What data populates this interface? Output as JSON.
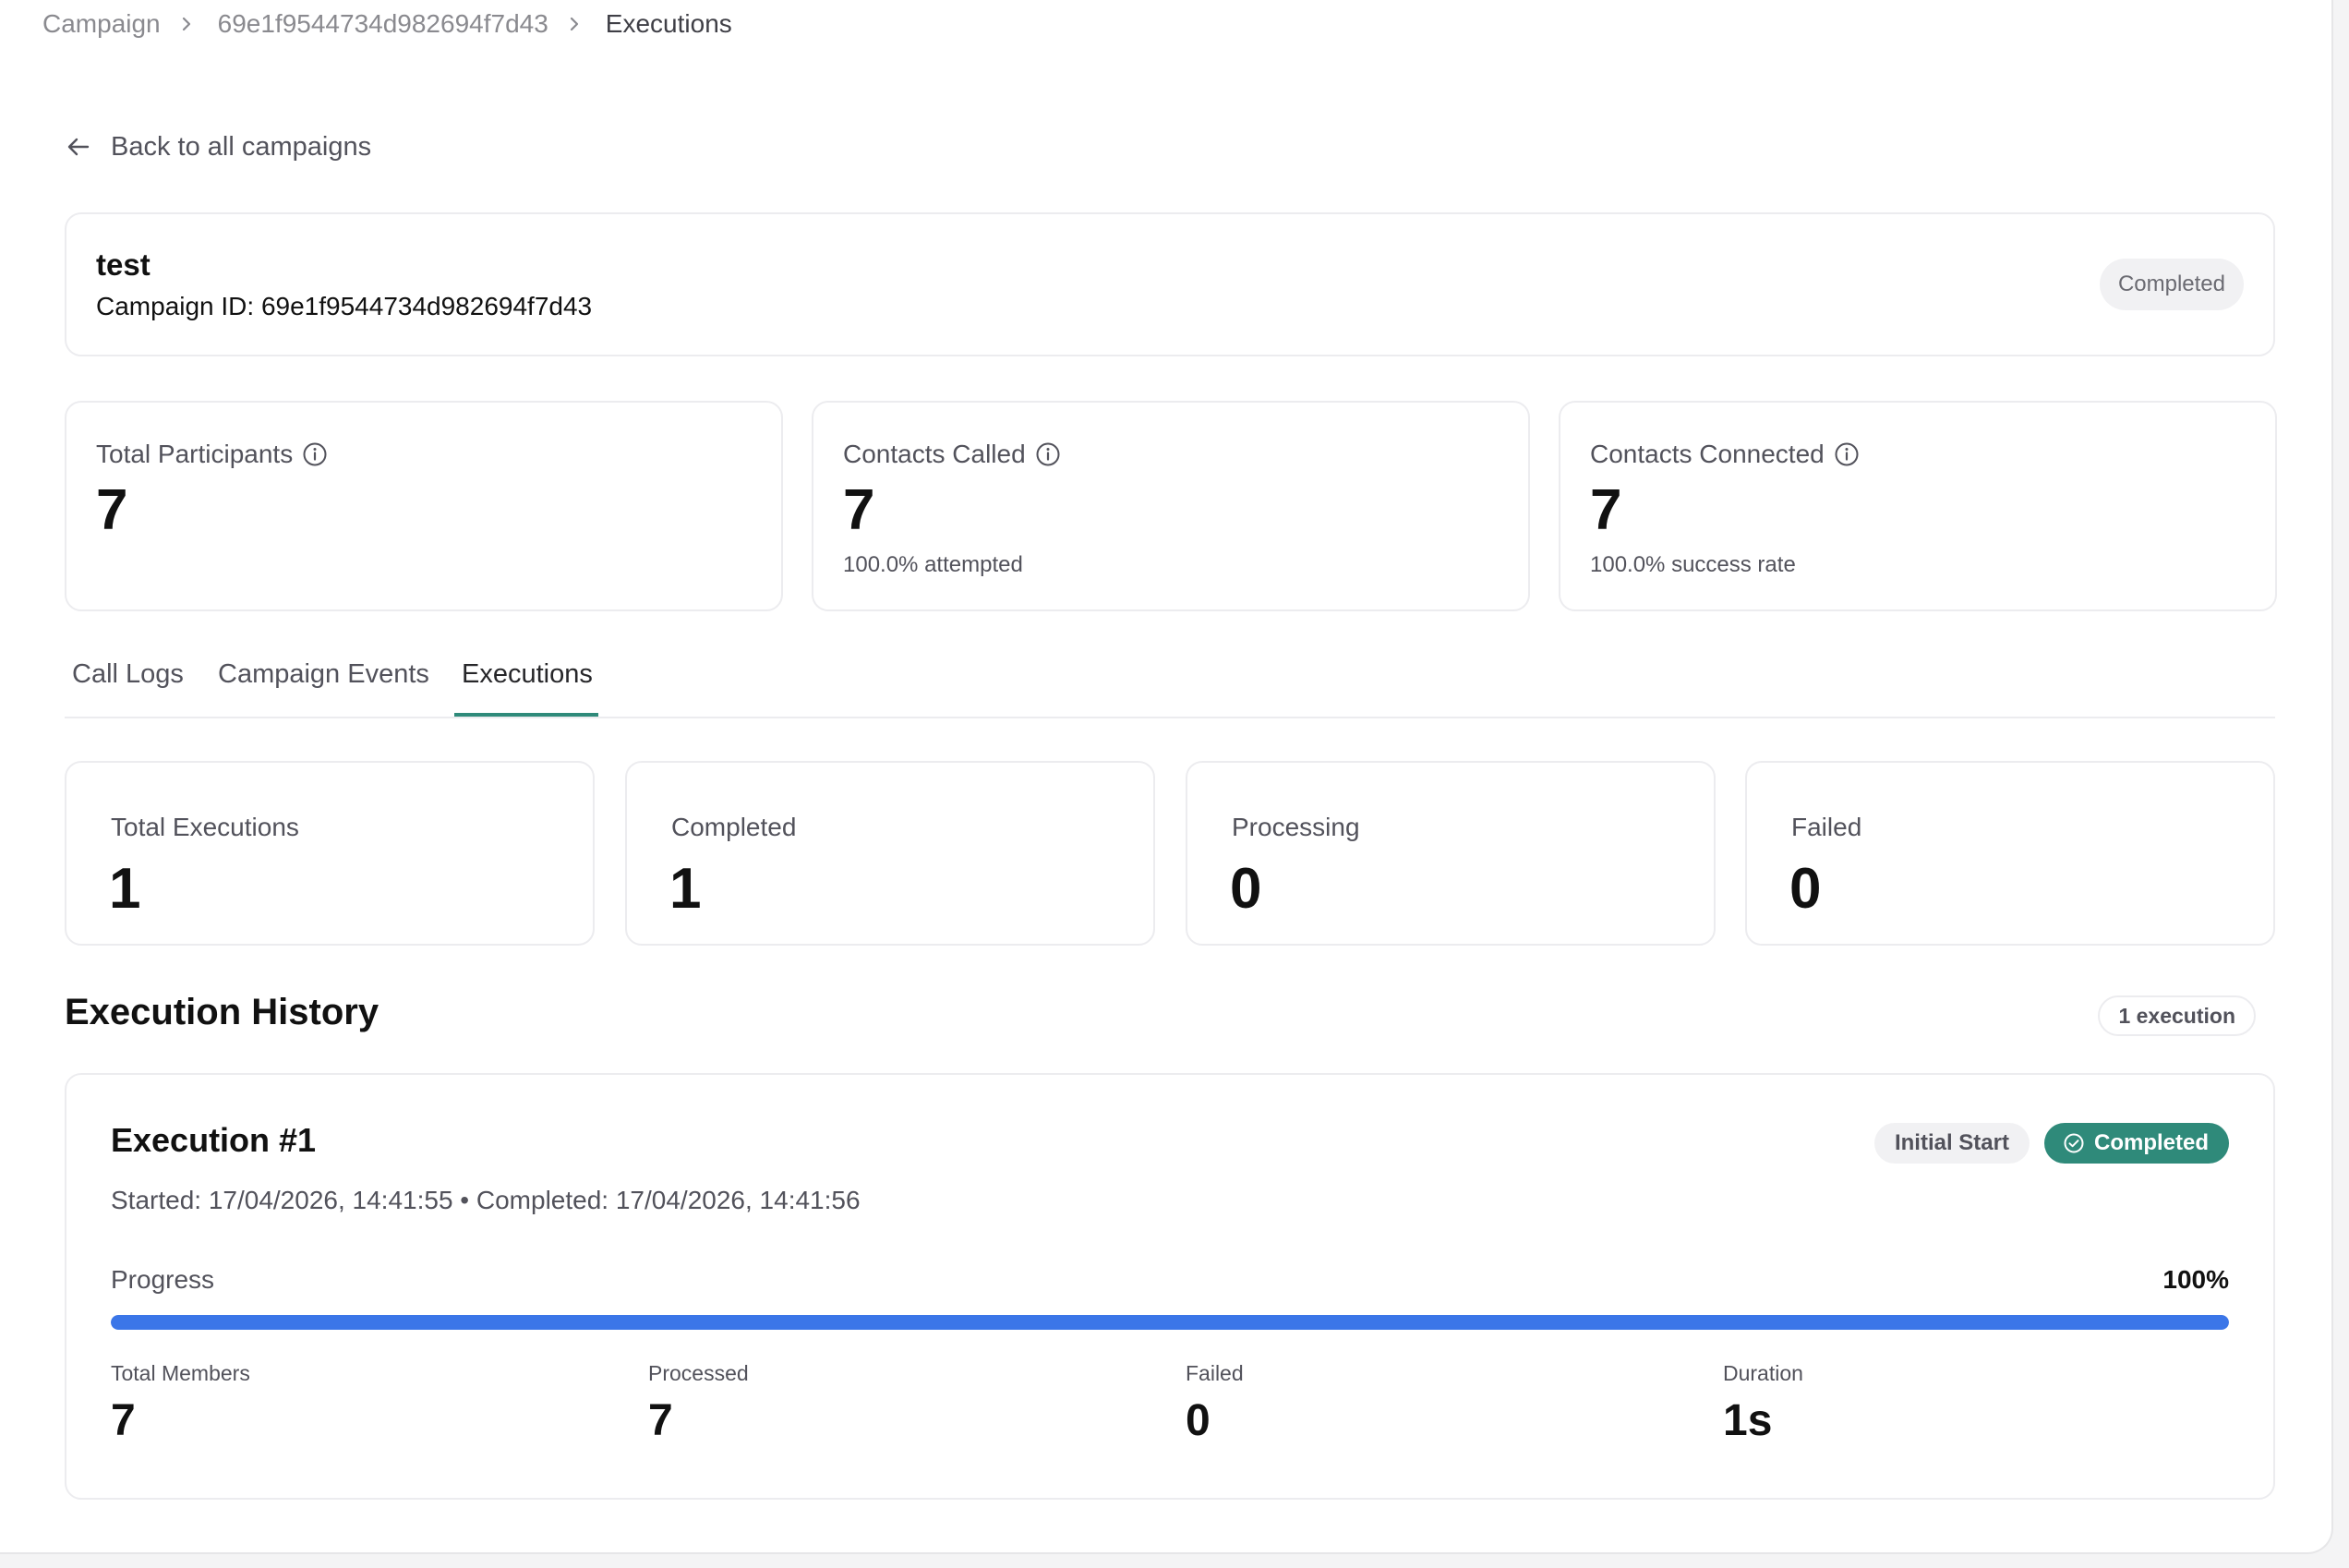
{
  "breadcrumb": {
    "items": [
      "Campaign",
      "69e1f9544734d982694f7d43",
      "Executions"
    ]
  },
  "back_link": {
    "label": "Back to all campaigns",
    "icon": "arrow-left-icon"
  },
  "campaign": {
    "name": "test",
    "id_text": "Campaign ID: 69e1f9544734d982694f7d43",
    "status": "Completed"
  },
  "stats": [
    {
      "label": "Total Participants",
      "value": "7",
      "sub": ""
    },
    {
      "label": "Contacts Called",
      "value": "7",
      "sub": "100.0% attempted"
    },
    {
      "label": "Contacts Connected",
      "value": "7",
      "sub": "100.0% success rate"
    }
  ],
  "tabs": [
    {
      "label": "Call Logs"
    },
    {
      "label": "Campaign Events"
    },
    {
      "label": "Executions",
      "active": true
    }
  ],
  "execution_stats": [
    {
      "label": "Total Executions",
      "value": "1"
    },
    {
      "label": "Completed",
      "value": "1"
    },
    {
      "label": "Processing",
      "value": "0"
    },
    {
      "label": "Failed",
      "value": "0"
    }
  ],
  "history": {
    "title": "Execution History",
    "count_label": "1 execution",
    "executions": [
      {
        "title": "Execution #1",
        "trigger_badge": "Initial Start",
        "status_badge": "Completed",
        "times": "Started: 17/04/2026, 14:41:55 • Completed: 17/04/2026, 14:41:56",
        "progress_label": "Progress",
        "progress_text": "100%",
        "progress_fraction": 1.0,
        "metrics": [
          {
            "label": "Total Members",
            "value": "7"
          },
          {
            "label": "Processed",
            "value": "7"
          },
          {
            "label": "Failed",
            "value": "0"
          },
          {
            "label": "Duration",
            "value": "1s"
          }
        ]
      }
    ]
  },
  "colors": {
    "accent_teal": "#2f8a7a",
    "progress_blue": "#3b76e8",
    "muted_text": "#52525b",
    "border": "#ececef"
  }
}
